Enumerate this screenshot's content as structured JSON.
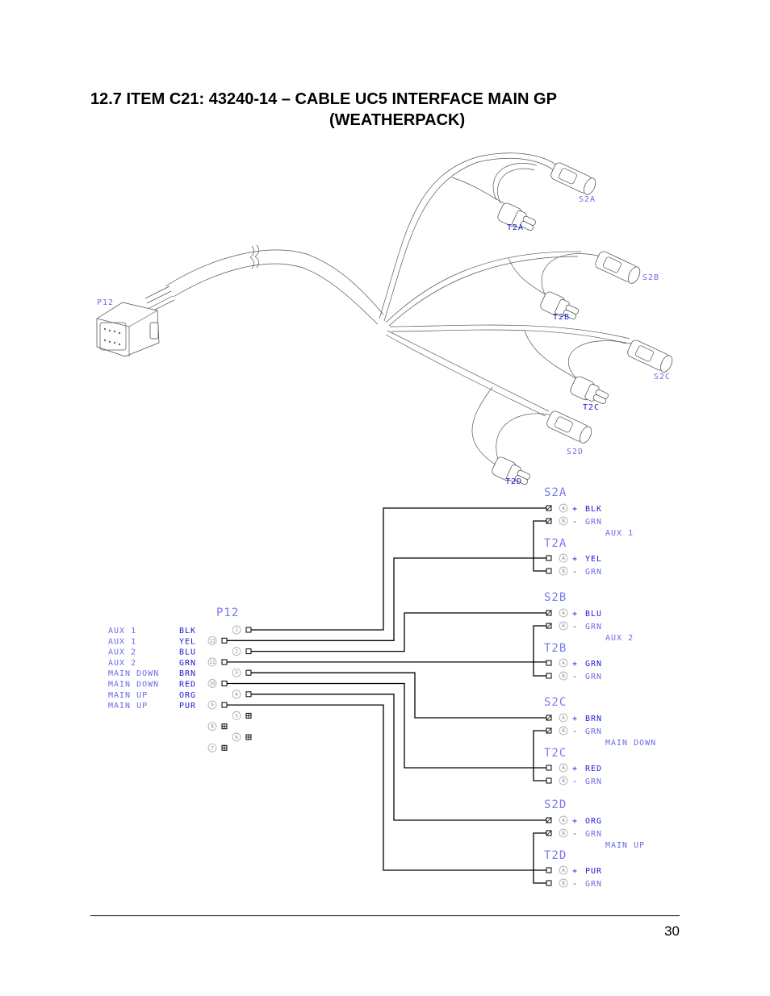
{
  "header": {
    "title_line1": "12.7  ITEM C21:  43240-14 – CABLE UC5 INTERFACE MAIN GP",
    "title_line2": "(WEATHERPACK)"
  },
  "drawing": {
    "labels": {
      "p12": "P12",
      "s2a": "S2A",
      "t2a": "T2A",
      "s2b": "S2B",
      "t2b": "T2B",
      "s2c": "S2C",
      "t2c": "T2C",
      "s2d": "S2D",
      "t2d": "T2D"
    }
  },
  "schematic": {
    "p12_label": "P12",
    "functions": [
      {
        "name": "AUX 1",
        "color": "BLK",
        "pin": "1"
      },
      {
        "name": "AUX 1",
        "color": "YEL",
        "pin": "12"
      },
      {
        "name": "AUX 2",
        "color": "BLU",
        "pin": "2"
      },
      {
        "name": "AUX 2",
        "color": "GRN",
        "pin": "11"
      },
      {
        "name": "MAIN DOWN",
        "color": "BRN",
        "pin": "3"
      },
      {
        "name": "MAIN DOWN",
        "color": "RED",
        "pin": "10"
      },
      {
        "name": "MAIN UP",
        "color": "ORG",
        "pin": "4"
      },
      {
        "name": "MAIN UP",
        "color": "PUR",
        "pin": "9"
      }
    ],
    "unused_pins": [
      "5",
      "8",
      "6",
      "7"
    ],
    "groups": [
      {
        "function": "AUX 1",
        "s_label": "S2A",
        "s_pins": [
          {
            "pin": "A",
            "sign": "+",
            "color": "BLK"
          },
          {
            "pin": "B",
            "sign": "-",
            "color": "GRN"
          }
        ],
        "t_label": "T2A",
        "t_pins": [
          {
            "pin": "A",
            "sign": "+",
            "color": "YEL"
          },
          {
            "pin": "B",
            "sign": "-",
            "color": "GRN"
          }
        ]
      },
      {
        "function": "AUX 2",
        "s_label": "S2B",
        "s_pins": [
          {
            "pin": "A",
            "sign": "+",
            "color": "BLU"
          },
          {
            "pin": "B",
            "sign": "-",
            "color": "GRN"
          }
        ],
        "t_label": "T2B",
        "t_pins": [
          {
            "pin": "A",
            "sign": "+",
            "color": "GRN"
          },
          {
            "pin": "B",
            "sign": "-",
            "color": "GRN"
          }
        ]
      },
      {
        "function": "MAIN DOWN",
        "s_label": "S2C",
        "s_pins": [
          {
            "pin": "A",
            "sign": "+",
            "color": "BRN"
          },
          {
            "pin": "B",
            "sign": "-",
            "color": "GRN"
          }
        ],
        "t_label": "T2C",
        "t_pins": [
          {
            "pin": "A",
            "sign": "+",
            "color": "RED"
          },
          {
            "pin": "B",
            "sign": "-",
            "color": "GRN"
          }
        ]
      },
      {
        "function": "MAIN UP",
        "s_label": "S2D",
        "s_pins": [
          {
            "pin": "A",
            "sign": "+",
            "color": "ORG"
          },
          {
            "pin": "B",
            "sign": "-",
            "color": "GRN"
          }
        ],
        "t_label": "T2D",
        "t_pins": [
          {
            "pin": "A",
            "sign": "+",
            "color": "PUR"
          },
          {
            "pin": "B",
            "sign": "-",
            "color": "GRN"
          }
        ]
      }
    ]
  },
  "footer": {
    "page_number": "30"
  }
}
